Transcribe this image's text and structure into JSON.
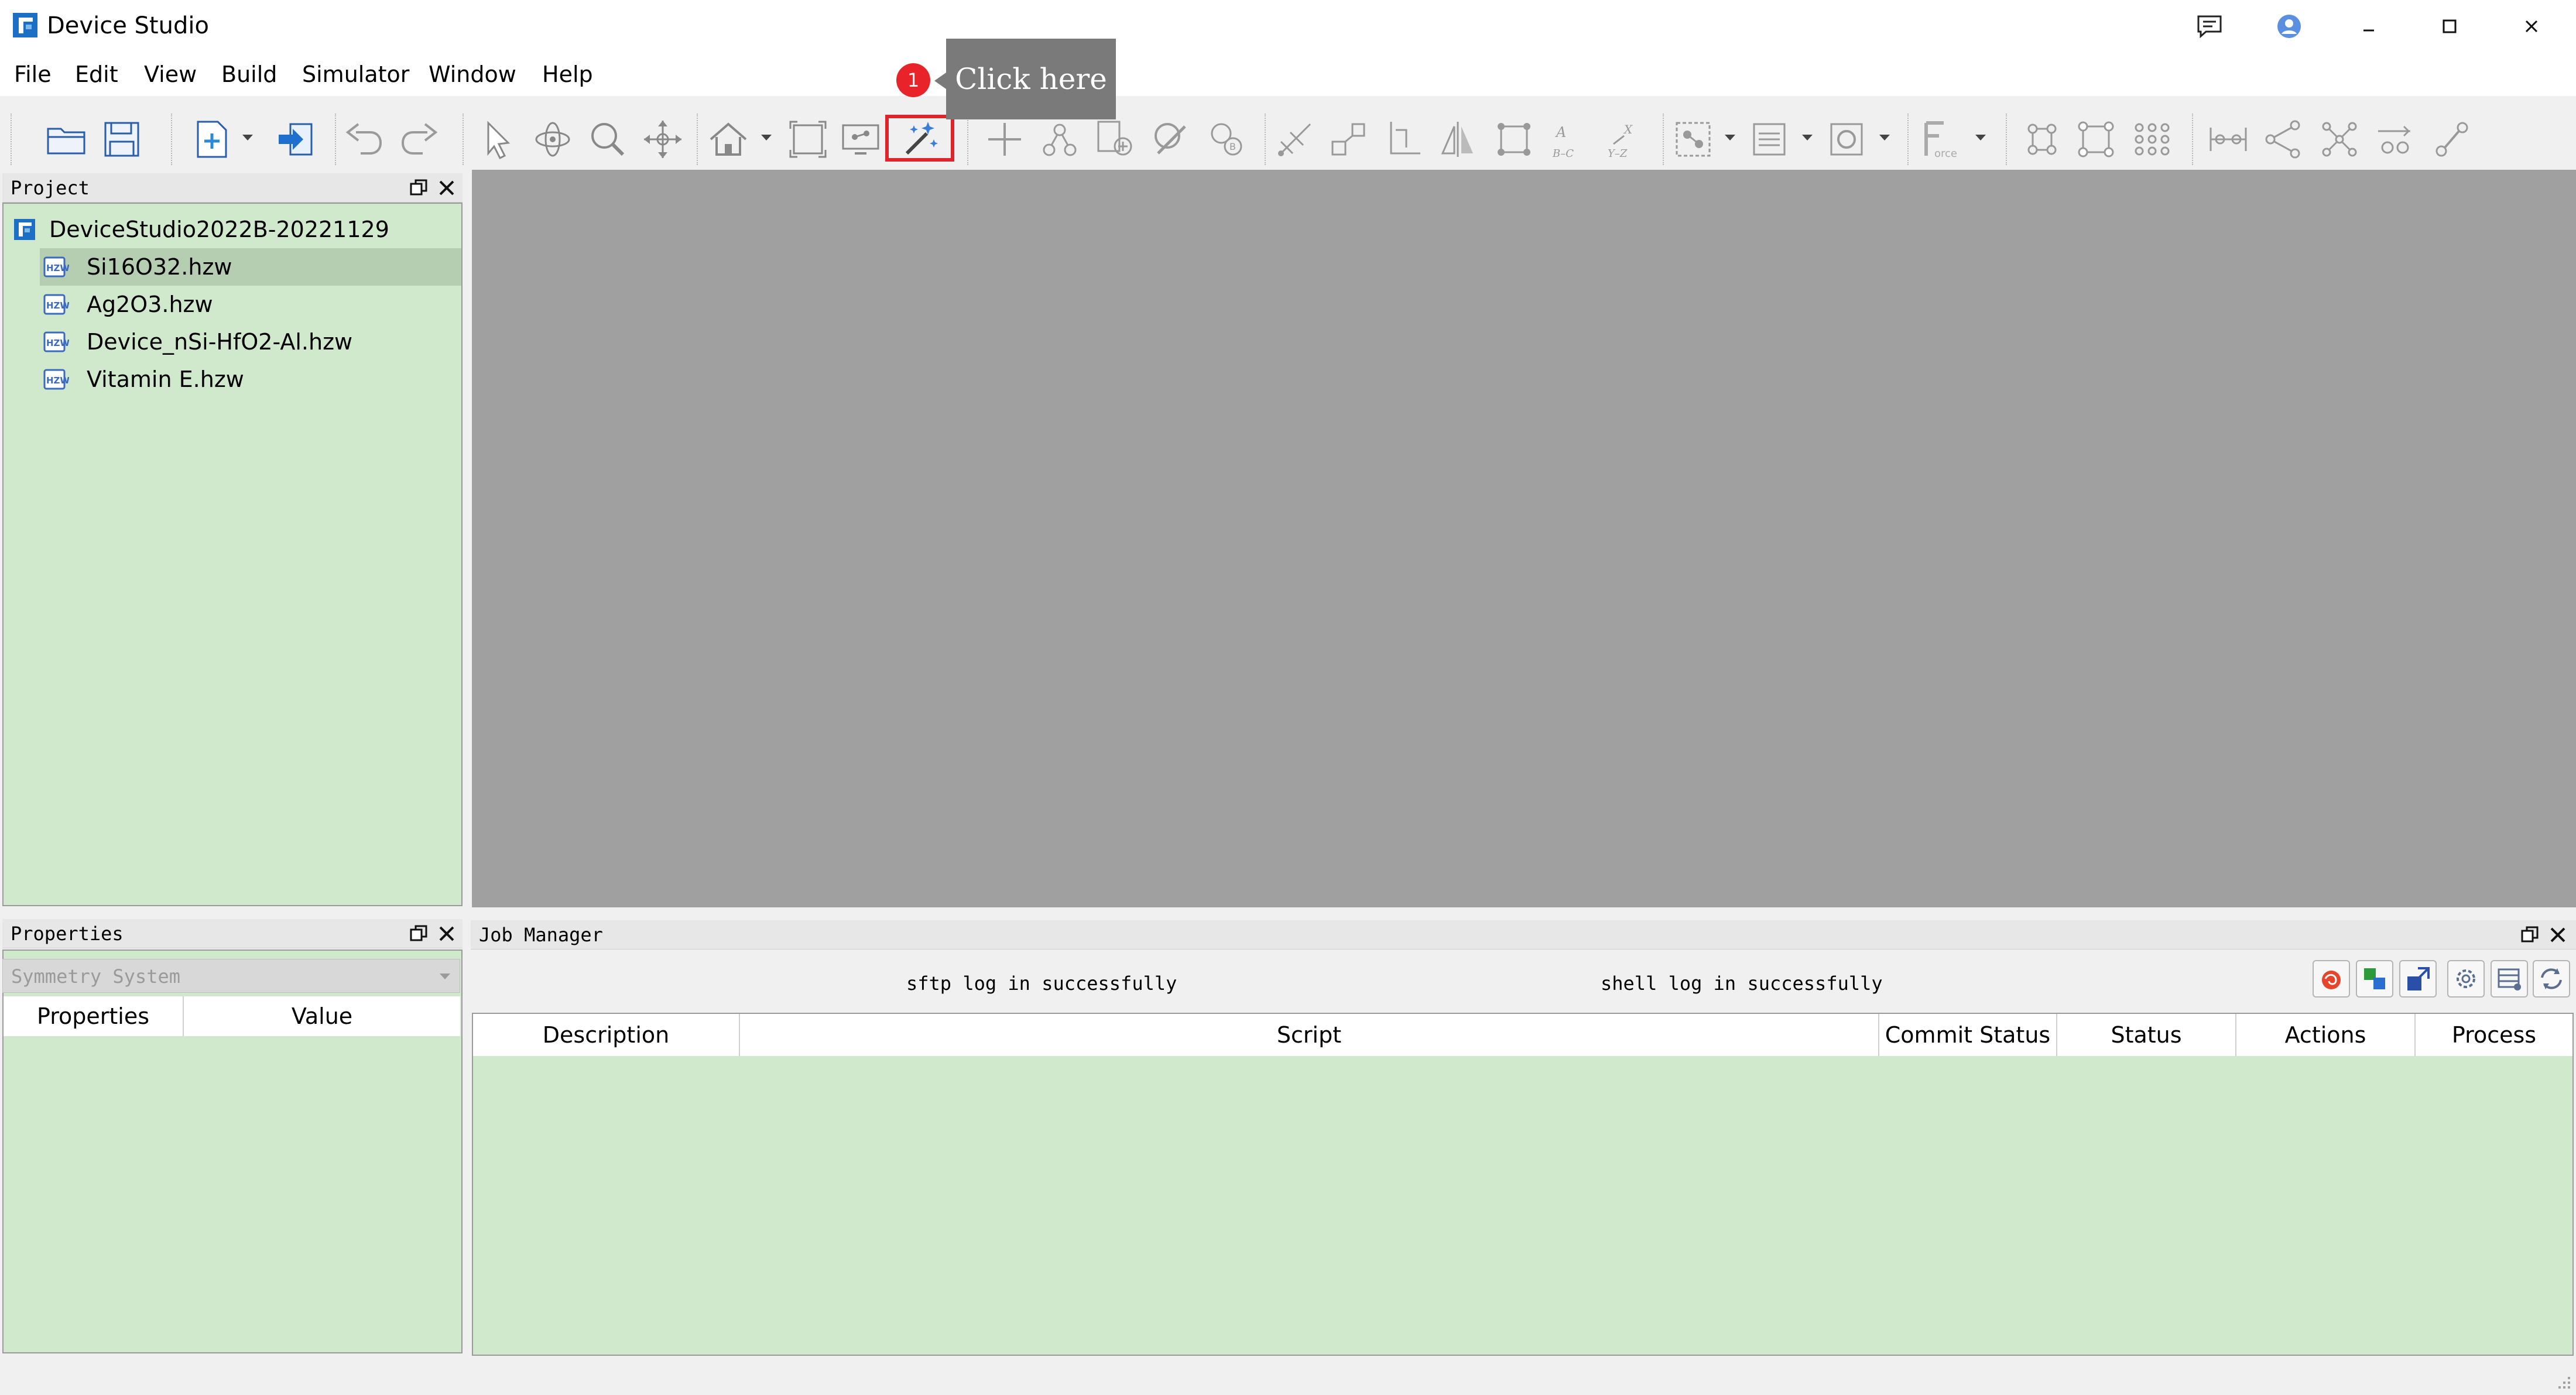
{
  "app": {
    "title": "Device Studio",
    "accent": "#1b6fc4"
  },
  "menu": [
    "File",
    "Edit",
    "View",
    "Build",
    "Simulator",
    "Window",
    "Help"
  ],
  "toolbar": {
    "highlighted_tool": "magic-wand-icon",
    "icons": [
      "open-folder-icon",
      "save-icon",
      "new-document-icon",
      "import-icon",
      "undo-icon",
      "redo-icon",
      "select-arrow-icon",
      "rotate-icon",
      "zoom-icon",
      "move-icon",
      "home-view-icon",
      "fit-view-icon",
      "display-settings-icon",
      "magic-wand-icon",
      "add-atom-icon",
      "bond-icon",
      "add-fragment-icon",
      "delete-icon",
      "element-icon",
      "measure-icon",
      "scale-icon",
      "axis-icon",
      "mirror-icon",
      "cell-icon",
      "distance-icon",
      "angle-icon",
      "group-icon",
      "align-icon",
      "layout-icon",
      "force-icon",
      "molecule-icon",
      "lattice-icon",
      "supercell-icon",
      "electrode-icon",
      "junction-icon",
      "network-icon",
      "transport-icon",
      "link-icon"
    ]
  },
  "callout": {
    "number": "1",
    "text": "Click here",
    "color": "#e8232a"
  },
  "project_panel": {
    "title": "Project",
    "root": "DeviceStudio2022B-20221129",
    "files": [
      {
        "label": "Si16O32.hzw",
        "selected": true
      },
      {
        "label": "Ag2O3.hzw",
        "selected": false
      },
      {
        "label": "Device_nSi-HfO2-Al.hzw",
        "selected": false
      },
      {
        "label": "Vitamin E.hzw",
        "selected": false
      }
    ]
  },
  "properties_panel": {
    "title": "Properties",
    "dropdown_value": "Symmetry System",
    "columns": [
      "Properties",
      "Value"
    ]
  },
  "job_manager": {
    "title": "Job Manager",
    "sftp_status": "sftp log in successfully",
    "shell_status": "shell log in successfully",
    "columns": [
      "Description",
      "Script",
      "Commit Status",
      "Status",
      "Actions",
      "Process"
    ],
    "buttons": [
      "red-swirl-icon",
      "connect-icon",
      "submit-icon",
      "settings-icon",
      "config-icon",
      "refresh-icon"
    ]
  },
  "colors": {
    "panel_green": "#d0e9cc",
    "viewport_gray": "#a0a0a0",
    "selection_green": "#b5cdb0"
  }
}
